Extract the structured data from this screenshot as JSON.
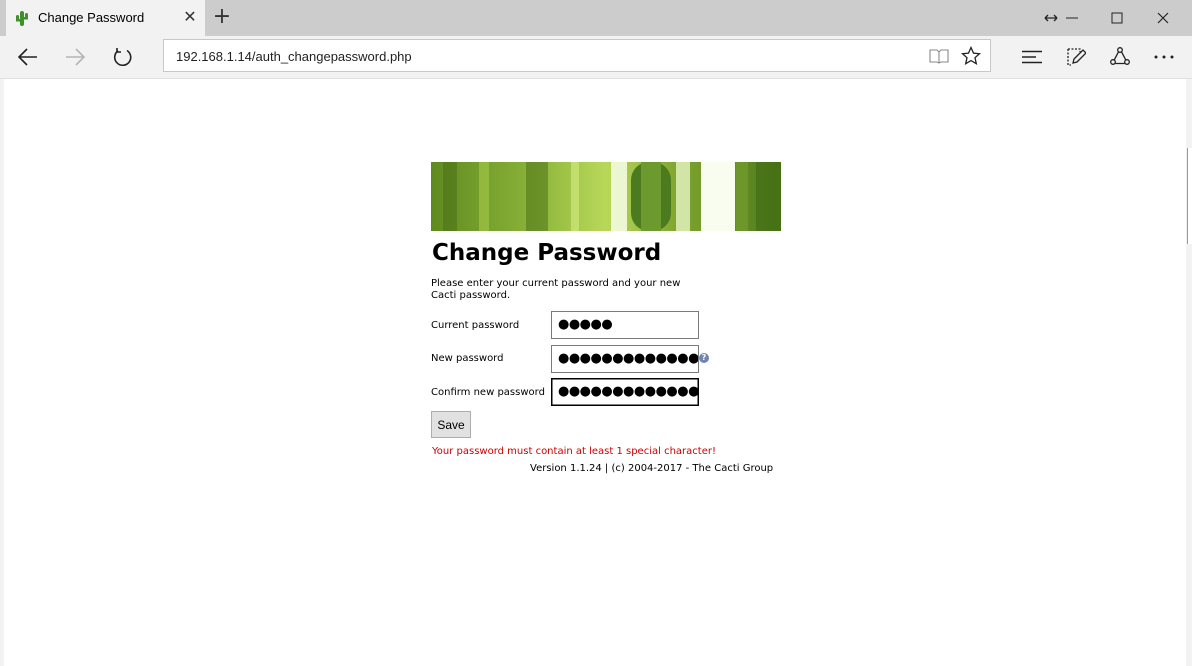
{
  "browser": {
    "tab": {
      "title": "Change Password"
    },
    "url": "192.168.1.14/auth_changepassword.php"
  },
  "page": {
    "heading": "Change Password",
    "intro": "Please enter your current password and your new Cacti password.",
    "fields": [
      {
        "label": "Current password",
        "masked_value": "●●●●●"
      },
      {
        "label": "New password",
        "masked_value": "●●●●●●●●●●●●●●"
      },
      {
        "label": "Confirm new password",
        "masked_value": "●●●●●●●●●●●●●●"
      }
    ],
    "help_icon": "?",
    "save_label": "Save",
    "error_message": "Your password must contain at least 1 special character!",
    "footer": "Version 1.1.24 | (c) 2004-2017 - The Cacti Group"
  },
  "colors": {
    "error": "#cc0000",
    "tabstrip": "#cccccc",
    "chrome": "#f2f2f2",
    "banner_green": "#8fb43a"
  },
  "icons": {
    "favicon": "cactus-icon",
    "back": "back-arrow-icon",
    "forward": "forward-arrow-icon",
    "refresh": "refresh-icon",
    "reading_view": "book-icon",
    "favorite": "star-icon",
    "hub": "hub-icon",
    "web_note": "pen-note-icon",
    "share": "share-icon",
    "more": "more-dots-icon"
  }
}
